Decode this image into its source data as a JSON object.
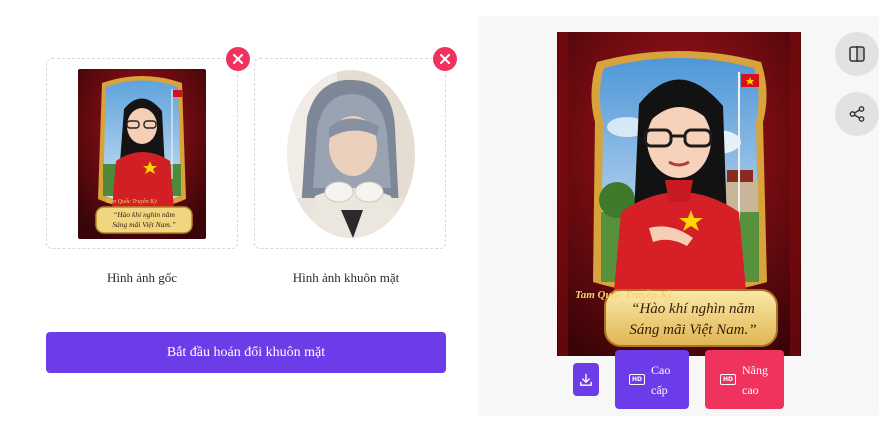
{
  "upload": {
    "original_caption": "Hình ảnh gốc",
    "face_caption": "Hình ảnh khuôn mặt"
  },
  "actions": {
    "start_swap_label": "Bắt đầu hoán đổi khuôn mặt",
    "hd_badge": "HD",
    "premium_line1": "Cao",
    "premium_line2": "cấp",
    "advanced_line1": "Nâng",
    "advanced_line2": "cao"
  },
  "poster": {
    "quote_line1": "“Hào khí nghìn năm",
    "quote_line2": "Sáng mãi Việt Nam.”",
    "logo_text": "Tam Quốc Truyền Kỳ"
  },
  "icons": {
    "remove": "close-icon",
    "compare": "compare-icon",
    "share": "share-icon",
    "download": "download-icon"
  },
  "colors": {
    "primary": "#6c3ce9",
    "danger": "#f0325e",
    "panel": "#f7f7f8"
  }
}
